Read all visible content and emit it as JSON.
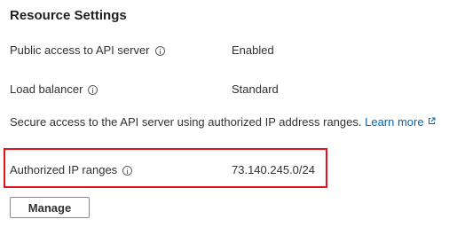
{
  "section": {
    "title": "Resource Settings"
  },
  "settings": [
    {
      "label": "Public access to API server",
      "value": "Enabled",
      "info_icon": "info-icon"
    },
    {
      "label": "Load balancer",
      "value": "Standard",
      "info_icon": "info-icon"
    }
  ],
  "description": {
    "text": "Secure access to the API server using authorized IP address ranges.",
    "link_label": "Learn more",
    "link_icon": "external-link-icon"
  },
  "authorized_ip": {
    "label": "Authorized IP ranges",
    "value": "73.140.245.0/24",
    "info_icon": "info-icon",
    "highlight_color": "#e3131e"
  },
  "actions": {
    "manage_label": "Manage"
  },
  "colors": {
    "link": "#0067b8",
    "text": "#323130"
  }
}
